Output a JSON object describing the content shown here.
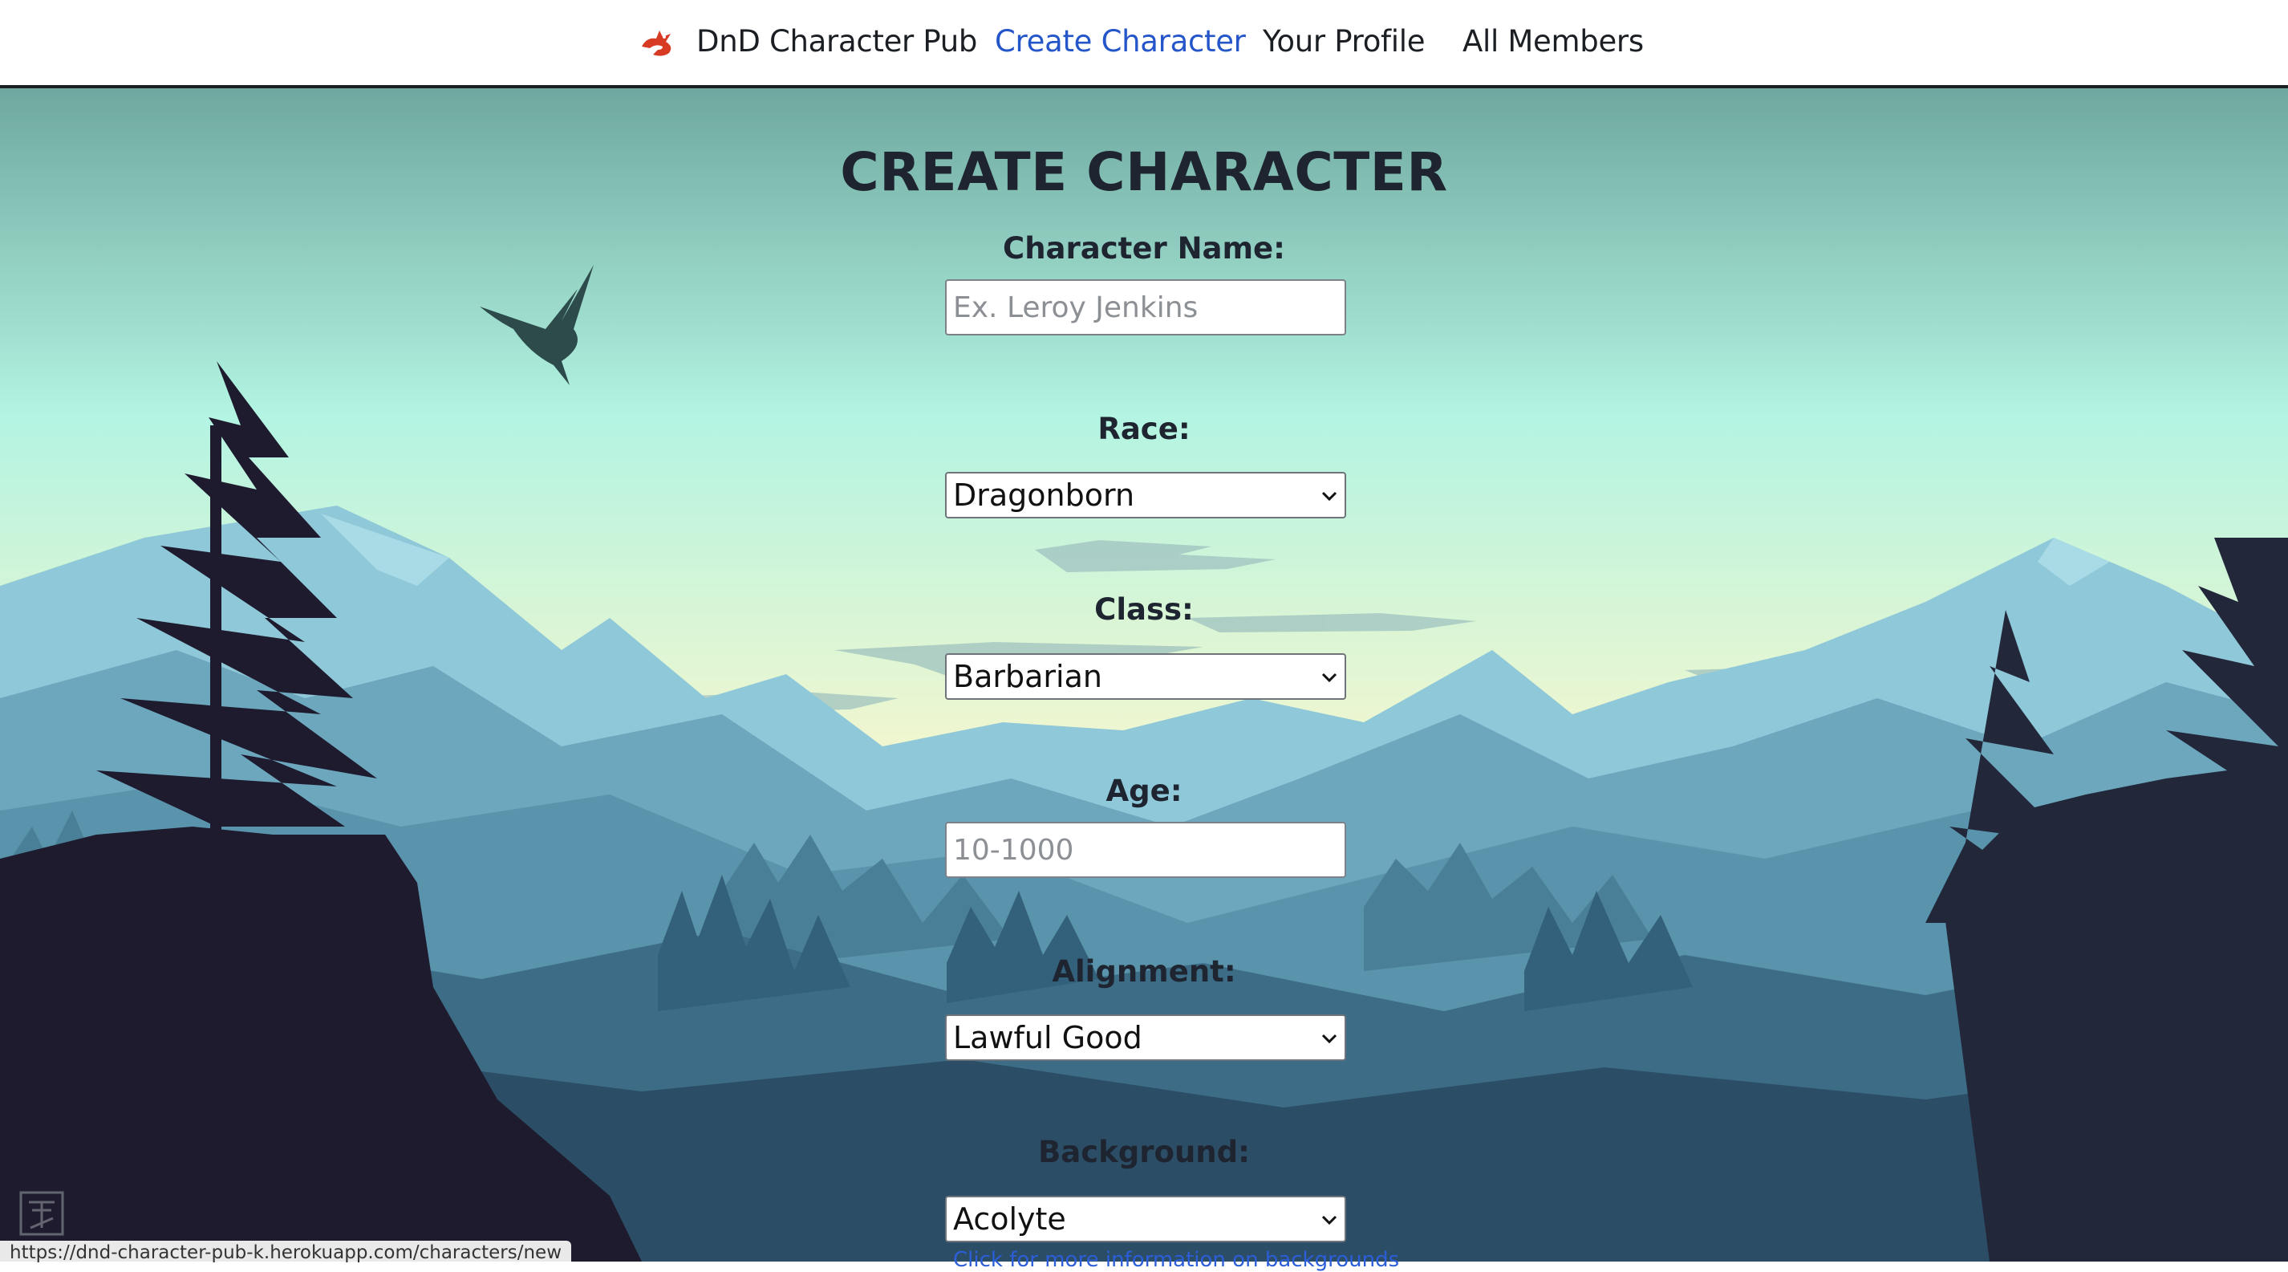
{
  "navbar": {
    "brand_icon": "dragon-logo-icon",
    "brand_text": "DnD Character Pub",
    "links": [
      {
        "label": "Create Character",
        "active": true
      },
      {
        "label": "Your Profile",
        "active": false
      },
      {
        "label": "All Members",
        "active": false
      }
    ],
    "active_color": "#2456c9"
  },
  "form": {
    "title": "CREATE CHARACTER",
    "name": {
      "label": "Character Name:",
      "placeholder": "Ex. Leroy Jenkins"
    },
    "race": {
      "label": "Race:",
      "value": "Dragonborn"
    },
    "class": {
      "label": "Class:",
      "value": "Barbarian"
    },
    "age": {
      "label": "Age:",
      "placeholder": "10-1000"
    },
    "alignment": {
      "label": "Alignment:",
      "value": "Lawful Good"
    },
    "background": {
      "label": "Background:",
      "value": "Acolyte"
    },
    "info_link": "Click for more information on backgrounds"
  },
  "status_bar": {
    "url": "https://dnd-character-pub-k.herokuapp.com/characters/new"
  },
  "colors": {
    "sky_top": "#6fa9a0",
    "sky_mid": "#b4f3e3",
    "horizon": "#f5f7cf",
    "foreground": "#1e1b2e"
  }
}
